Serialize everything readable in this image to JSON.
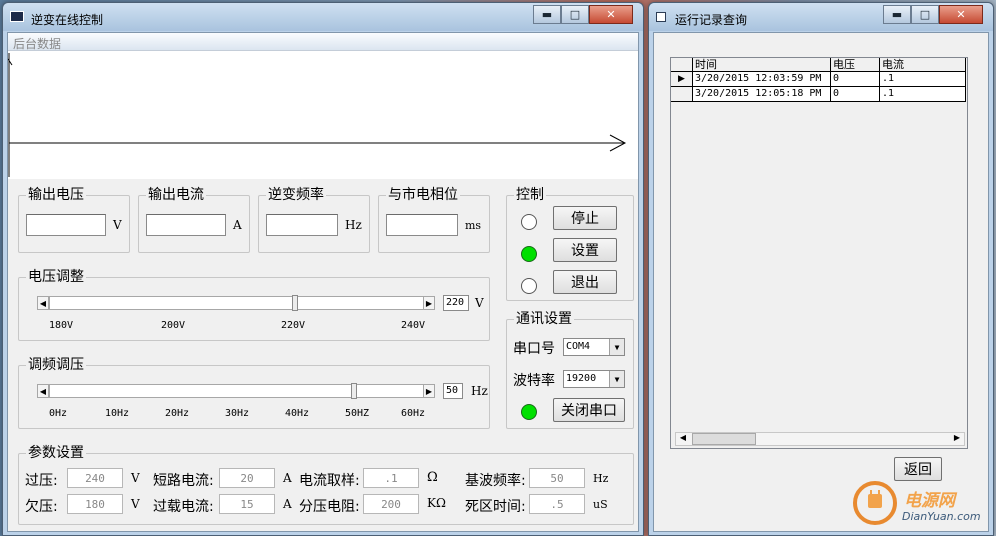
{
  "main_window": {
    "title": "逆变在线控制",
    "menu": "后台数据",
    "groups": {
      "out_voltage": {
        "title": "输出电压",
        "unit": "V"
      },
      "out_current": {
        "title": "输出电流",
        "unit": "A"
      },
      "inv_freq": {
        "title": "逆变频率",
        "unit": "Hz"
      },
      "phase": {
        "title": "与市电相位",
        "unit": "ms"
      }
    },
    "control": {
      "title": "控制",
      "stop": "停止",
      "set": "设置",
      "exit": "退出"
    },
    "voltage_adjust": {
      "title": "电压调整",
      "value": "220",
      "unit": "V",
      "ticks": [
        "180V",
        "200V",
        "220V",
        "240V"
      ],
      "level": 0.5
    },
    "freq_adjust": {
      "title": "调频调压",
      "value": "50",
      "unit": "Hz",
      "ticks": [
        "0Hz",
        "10Hz",
        "20Hz",
        "30Hz",
        "40Hz",
        "50HZ",
        "60Hz"
      ],
      "level": 0.83
    },
    "comm": {
      "title": "通讯设置",
      "port_label": "串口号",
      "port_value": "COM4",
      "baud_label": "波特率",
      "baud_value": "19200",
      "close_port": "关闭串口"
    },
    "params": {
      "title": "参数设置",
      "over_v_label": "过压:",
      "over_v": "240",
      "over_v_unit": "V",
      "under_v_label": "欠压:",
      "under_v": "180",
      "under_v_unit": "V",
      "short_label": "短路电流:",
      "short": "20",
      "short_unit": "A",
      "overload_label": "过载电流:",
      "overload": "15",
      "overload_unit": "A",
      "sample_label": "电流取样:",
      "sample": ".1",
      "sample_unit": "Ω",
      "divider_label": "分压电阻:",
      "divider": "200",
      "divider_unit": "KΩ",
      "base_freq_label": "基波频率:",
      "base_freq": "50",
      "base_freq_unit": "Hz",
      "dead_time_label": "死区时间:",
      "dead_time": ".5",
      "dead_time_unit": "uS"
    }
  },
  "log_window": {
    "title": "运行记录查询",
    "columns": [
      "时间",
      "电压",
      "电流"
    ],
    "rows": [
      {
        "time": "3/20/2015 12:03:59 PM",
        "voltage": "0",
        "current": ".1"
      },
      {
        "time": "3/20/2015 12:05:18 PM",
        "voltage": "0",
        "current": ".1"
      }
    ],
    "back": "返回"
  },
  "watermark": {
    "name": "电源网",
    "site": "DianYuan.com"
  },
  "colors": {
    "led_on": "#00e000",
    "titlebar": "#bcd2e9",
    "close": "#c64a33"
  }
}
